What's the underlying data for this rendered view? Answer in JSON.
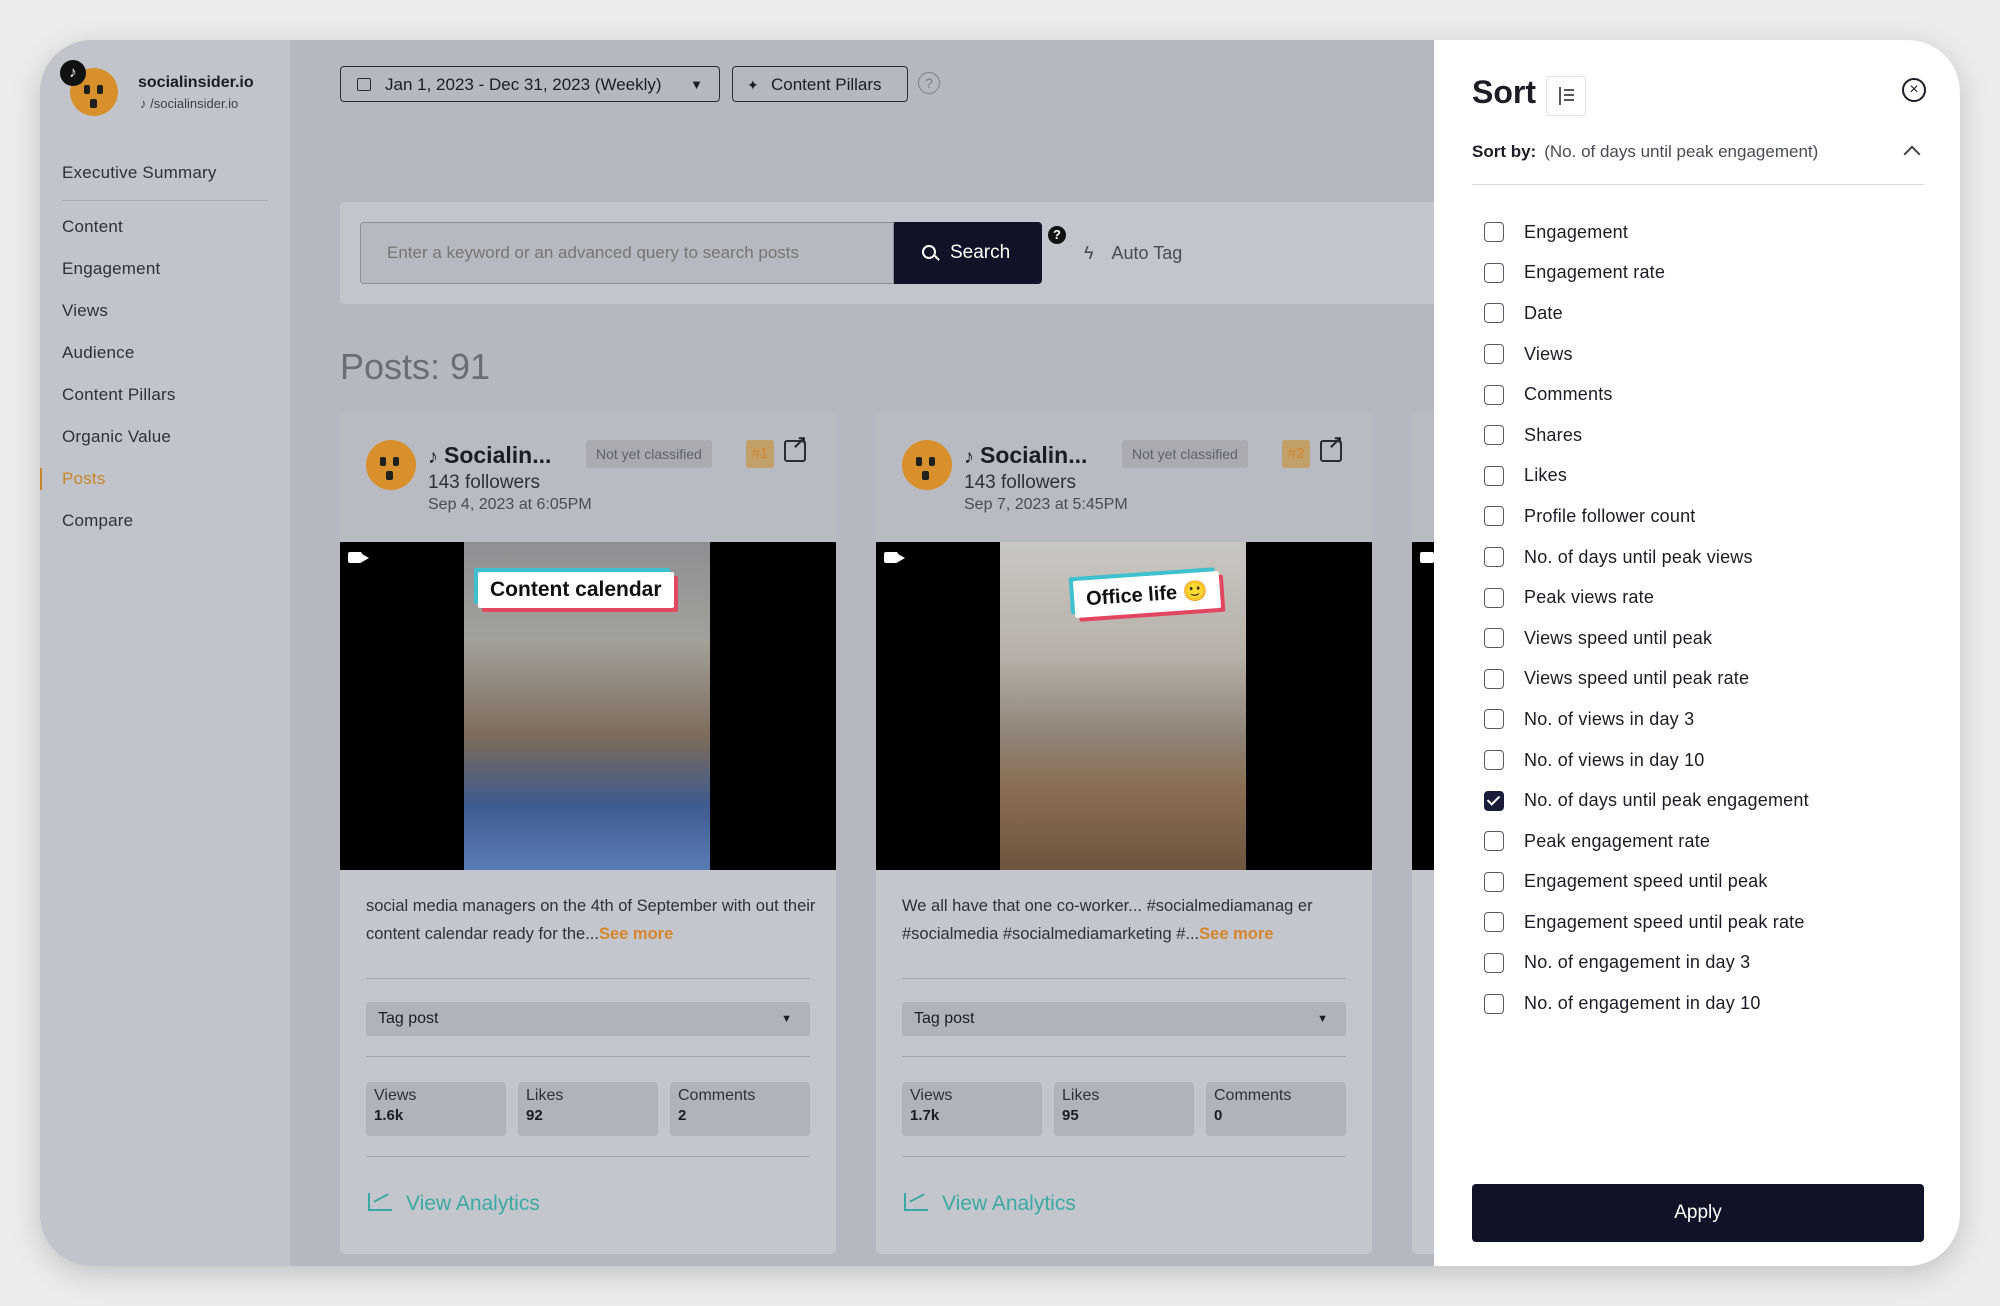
{
  "brand": {
    "name": "socialinsider.io",
    "handle": "/socialinsider.io"
  },
  "sidebar": {
    "items": [
      {
        "label": "Executive Summary"
      },
      {
        "label": "Content"
      },
      {
        "label": "Engagement"
      },
      {
        "label": "Views"
      },
      {
        "label": "Audience"
      },
      {
        "label": "Content Pillars"
      },
      {
        "label": "Organic Value"
      },
      {
        "label": "Posts",
        "active": true
      },
      {
        "label": "Compare"
      }
    ]
  },
  "topbar": {
    "date_range": "Jan 1, 2023 - Dec 31, 2023 (Weekly)",
    "content_pillars": "Content Pillars",
    "help": "?"
  },
  "search": {
    "placeholder": "Enter a keyword or an advanced query to search posts",
    "button": "Search",
    "help": "?",
    "auto_tag": "Auto Tag"
  },
  "posts": {
    "title": "Posts: 91",
    "cards": [
      {
        "account": "Socialin...",
        "classification": "Not yet classified",
        "rank": "#1",
        "followers": "143 followers",
        "date": "Sep 4, 2023 at 6:05PM",
        "thumb_text": "Content calendar",
        "caption": "social media managers on the 4th of September with out their content calendar ready for the...",
        "see_more": "See more",
        "tag_select": "Tag post",
        "stats": [
          {
            "label": "Views",
            "value": "1.6k"
          },
          {
            "label": "Likes",
            "value": "92"
          },
          {
            "label": "Comments",
            "value": "2"
          }
        ],
        "view_analytics": "View Analytics"
      },
      {
        "account": "Socialin...",
        "classification": "Not yet classified",
        "rank": "#2",
        "followers": "143 followers",
        "date": "Sep 7, 2023 at 5:45PM",
        "thumb_text": "Office life 🙂",
        "caption": "We all have that one co-worker... #socialmediamanag er #socialmedia #socialmediamarketing #...",
        "see_more": "See more",
        "tag_select": "Tag post",
        "stats": [
          {
            "label": "Views",
            "value": "1.7k"
          },
          {
            "label": "Likes",
            "value": "95"
          },
          {
            "label": "Comments",
            "value": "0"
          }
        ],
        "view_analytics": "View Analytics"
      }
    ]
  },
  "sort": {
    "title": "Sort",
    "sort_by_label": "Sort by:",
    "sort_by_value": "(No. of days until peak engagement)",
    "options": [
      {
        "label": "Engagement",
        "checked": false
      },
      {
        "label": "Engagement rate",
        "checked": false
      },
      {
        "label": "Date",
        "checked": false
      },
      {
        "label": "Views",
        "checked": false
      },
      {
        "label": "Comments",
        "checked": false
      },
      {
        "label": "Shares",
        "checked": false
      },
      {
        "label": "Likes",
        "checked": false
      },
      {
        "label": "Profile follower count",
        "checked": false
      },
      {
        "label": "No. of days until peak views",
        "checked": false
      },
      {
        "label": "Peak views rate",
        "checked": false
      },
      {
        "label": "Views speed until peak",
        "checked": false
      },
      {
        "label": "Views speed until peak rate",
        "checked": false
      },
      {
        "label": "No. of views in day 3",
        "checked": false
      },
      {
        "label": "No. of views in day 10",
        "checked": false
      },
      {
        "label": "No. of days until peak engagement",
        "checked": true
      },
      {
        "label": "Peak engagement rate",
        "checked": false
      },
      {
        "label": "Engagement speed until peak",
        "checked": false
      },
      {
        "label": "Engagement speed until peak rate",
        "checked": false
      },
      {
        "label": "No. of engagement in day 3",
        "checked": false
      },
      {
        "label": "No. of engagement in day 10",
        "checked": false
      }
    ],
    "apply": "Apply"
  },
  "colors": {
    "accent": "#d6852a",
    "primary": "#101328",
    "teal": "#3aa9a6"
  }
}
